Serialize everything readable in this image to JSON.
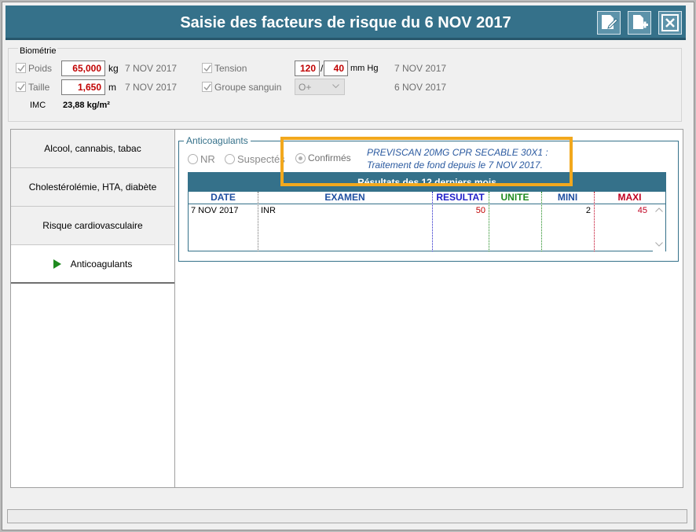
{
  "window": {
    "title": "Saisie des facteurs de risque du 6 NOV 2017",
    "buttons": [
      {
        "name": "edit-note-icon"
      },
      {
        "name": "new-document-icon"
      },
      {
        "name": "close-icon"
      }
    ]
  },
  "biometrie": {
    "legend": "Biométrie",
    "poids": {
      "label": "Poids",
      "value": "65,000",
      "unit": "kg",
      "date": "7 NOV 2017",
      "checked": true
    },
    "taille": {
      "label": "Taille",
      "value": "1,650",
      "unit": "m",
      "date": "7 NOV 2017",
      "checked": true
    },
    "imc": {
      "label": "IMC",
      "value": "23,88 kg/m²"
    },
    "tension": {
      "label": "Tension",
      "systolic": "120",
      "separator": "/",
      "diastolic": "40",
      "unit": "mm Hg",
      "date": "7 NOV 2017",
      "checked": true
    },
    "groupe": {
      "label": "Groupe sanguin",
      "value": "O+",
      "date": "6 NOV 2017",
      "checked": true
    }
  },
  "nav": {
    "items": [
      {
        "label": "Alcool, cannabis, tabac",
        "active": false
      },
      {
        "label": "Cholestérolémie, HTA, diabète",
        "active": false
      },
      {
        "label": "Risque cardiovasculaire",
        "active": false
      },
      {
        "label": "Anticoagulants",
        "active": true
      }
    ]
  },
  "anticoag": {
    "title": "Anticoagulants",
    "radios": [
      {
        "label": "NR",
        "selected": false
      },
      {
        "label": "Suspectés",
        "selected": false
      },
      {
        "label": "Confirmés",
        "selected": true
      }
    ],
    "treatment_line1": "PREVISCAN 20MG CPR SECABLE 30X1 :",
    "treatment_line2": "Traitement de fond depuis le 7 NOV 2017.",
    "grid": {
      "header": "Résultats des 12 derniers mois",
      "columns": [
        {
          "label": "DATE",
          "color": "#1f4fa0"
        },
        {
          "label": "EXAMEN",
          "color": "#1f4fa0"
        },
        {
          "label": "RESULTAT",
          "color": "#2020c8"
        },
        {
          "label": "UNITE",
          "color": "#1f8a1f"
        },
        {
          "label": "MINI",
          "color": "#1f4fa0"
        },
        {
          "label": "MAXI",
          "color": "#c00020"
        }
      ],
      "rows": [
        {
          "date": "7 NOV 2017",
          "examen": "INR",
          "resultat": "50",
          "unite": "",
          "mini": "2",
          "maxi": "45"
        }
      ]
    }
  },
  "colors": {
    "accent": "#35718a",
    "highlight": "#f2a81d",
    "value_red": "#c00000"
  }
}
